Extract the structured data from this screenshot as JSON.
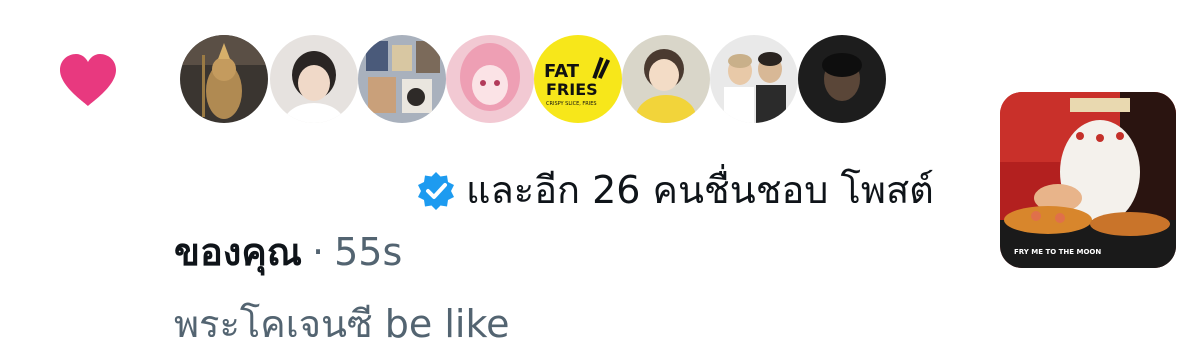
{
  "notification": {
    "type_icon": "heart-icon",
    "heart_color": "#e8397f",
    "avatars": [
      {
        "name": "avatar-1",
        "bg": "#3a3530"
      },
      {
        "name": "avatar-2",
        "bg": "#e6e2df"
      },
      {
        "name": "avatar-3",
        "bg": "#a9b1bd"
      },
      {
        "name": "avatar-4",
        "bg": "#f2c9d3"
      },
      {
        "name": "avatar-fat-fries",
        "bg": "#f7e71a",
        "logo_line1": "FAT",
        "logo_line2": "FRIES",
        "logo_sub": "CRISPY SLICE, FRIES"
      },
      {
        "name": "avatar-6",
        "bg": "#d9d6c9"
      },
      {
        "name": "avatar-7",
        "bg": "#e9e9e9"
      },
      {
        "name": "avatar-8",
        "bg": "#1d1d1d"
      }
    ],
    "verified_icon": "verified-badge-icon",
    "verified_color": "#1d9bf0",
    "likes_text": "และอีก 26 คนชื่นชอบ โพสต์",
    "owner_text": "ของคุณ",
    "separator": "·",
    "timestamp": "55s",
    "post_text": "พระโคเจนซี be like",
    "thumbnail_caption": "FRY ME TO THE MOON"
  }
}
